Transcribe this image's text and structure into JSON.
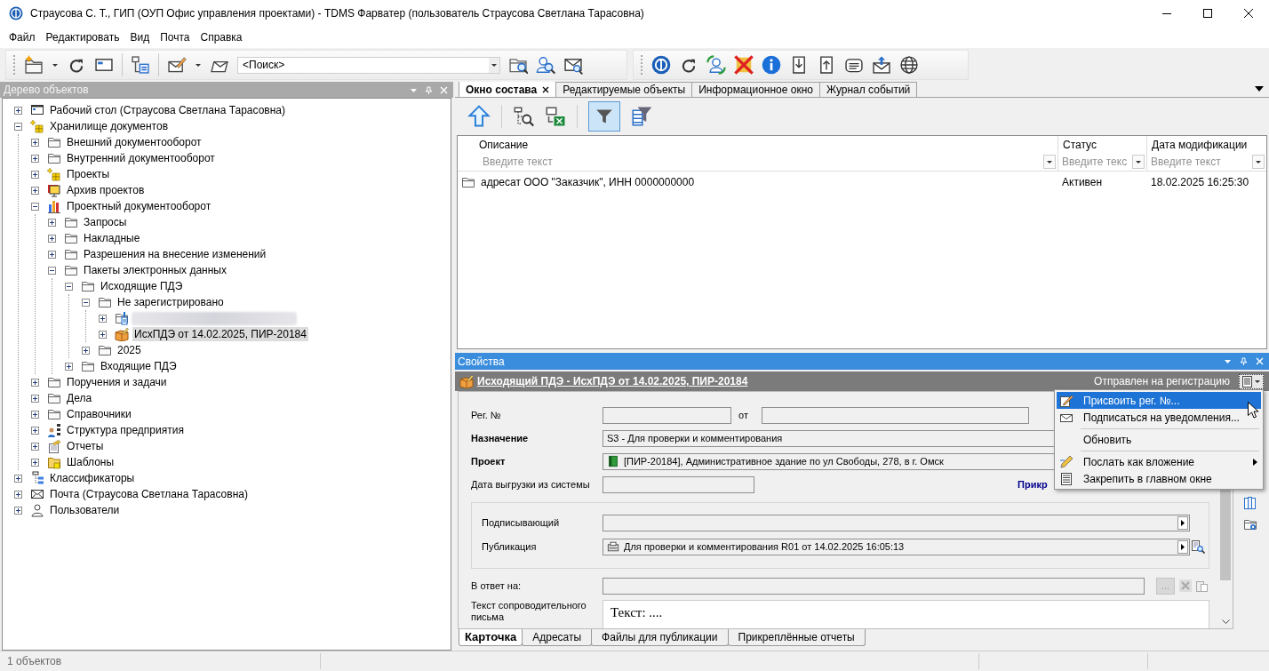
{
  "window": {
    "title": "Страусова С. Т., ГИП (ОУП Офис управления проектами) - TDMS Фарватер (пользователь Страусова Светлана Тарасовна)"
  },
  "menu": [
    "Файл",
    "Редактировать",
    "Вид",
    "Почта",
    "Справка"
  ],
  "toolbar": {
    "search": {
      "value": "<Поиск>"
    }
  },
  "tree_panel": {
    "title": "Дерево объектов",
    "items": [
      {
        "label": "Рабочий стол (Страусова Светлана Тарасовна)",
        "kind": "desktop",
        "expanded": false,
        "selected": false
      },
      {
        "label": "Хранилище документов",
        "kind": "storage",
        "expanded": true,
        "selected": false,
        "children": [
          {
            "label": "Внешний документооборот",
            "kind": "folder",
            "expanded": false,
            "selected": false
          },
          {
            "label": "Внутренний документооборот",
            "kind": "folder",
            "expanded": false,
            "selected": false
          },
          {
            "label": "Проекты",
            "kind": "storage",
            "expanded": false,
            "selected": false
          },
          {
            "label": "Архив проектов",
            "kind": "archive",
            "expanded": false,
            "selected": false
          },
          {
            "label": "Проектный документооборот",
            "kind": "chart",
            "expanded": true,
            "selected": false,
            "children": [
              {
                "label": "Запросы",
                "kind": "folder",
                "expanded": false,
                "selected": false
              },
              {
                "label": "Накладные",
                "kind": "folder",
                "expanded": false,
                "selected": false
              },
              {
                "label": "Разрешения на внесение изменений",
                "kind": "folder",
                "expanded": false,
                "selected": false
              },
              {
                "label": "Пакеты электронных данных",
                "kind": "folder",
                "expanded": true,
                "selected": false,
                "children": [
                  {
                    "label": "Исходящие ПДЭ",
                    "kind": "folder",
                    "expanded": true,
                    "selected": false,
                    "children": [
                      {
                        "label": "Не зарегистрировано",
                        "kind": "folder",
                        "expanded": true,
                        "selected": false,
                        "children": [
                          {
                            "kind": "package",
                            "blurred": true,
                            "expanded": false,
                            "selected": false
                          },
                          {
                            "label": "ИсхПДЭ от 14.02.2025, ПИР-20184",
                            "kind": "outgoing",
                            "expanded": false,
                            "selected": true
                          }
                        ]
                      },
                      {
                        "label": "2025",
                        "kind": "folder",
                        "expanded": false,
                        "selected": false
                      }
                    ]
                  },
                  {
                    "label": "Входящие ПДЭ",
                    "kind": "folder",
                    "expanded": false,
                    "selected": false
                  }
                ]
              }
            ]
          },
          {
            "label": "Поручения и задачи",
            "kind": "folder",
            "expanded": false,
            "selected": false
          },
          {
            "label": "Дела",
            "kind": "folder",
            "expanded": false,
            "selected": false
          },
          {
            "label": "Справочники",
            "kind": "folder",
            "expanded": false,
            "selected": false
          },
          {
            "label": "Структура предприятия",
            "kind": "orgchart",
            "expanded": false,
            "selected": false
          },
          {
            "label": "Отчеты",
            "kind": "reports",
            "expanded": false,
            "selected": false
          },
          {
            "label": "Шаблоны",
            "kind": "templates",
            "expanded": false,
            "selected": false
          }
        ]
      },
      {
        "label": "Классификаторы",
        "kind": "classifier",
        "expanded": false,
        "selected": false
      },
      {
        "label": "Почта (Страусова Светлана Тарасовна)",
        "kind": "mail",
        "expanded": false,
        "selected": false
      },
      {
        "label": "Пользователи",
        "kind": "user",
        "expanded": false,
        "selected": false
      }
    ]
  },
  "document_tabs": [
    {
      "label": "Окно состава",
      "selected": true
    },
    {
      "label": "Редактируемые объекты",
      "selected": false
    },
    {
      "label": "Информационное окно",
      "selected": false
    },
    {
      "label": "Журнал событий",
      "selected": false
    }
  ],
  "composition_toolbar": {
    "filter_on": true
  },
  "grid": {
    "columns": [
      {
        "label": "Описание",
        "filter_placeholder": "Введите текст"
      },
      {
        "label": "Статус",
        "filter_placeholder": "Введите текс"
      },
      {
        "label": "Дата модификации",
        "filter_placeholder": "Введите текст"
      }
    ],
    "rows": [
      {
        "cells": [
          "адресат ООО \"Заказчик\", ИНН 0000000000",
          "Активен",
          "18.02.2025 16:25:30"
        ]
      }
    ]
  },
  "properties": {
    "title": "Свойства",
    "object_title": "Исходящий ПДЭ - ИсхПДЭ от 14.02.2025, ПИР-20184",
    "status": "Отправлен на регистрацию",
    "fields": [
      {
        "kind": "reg",
        "label": "Рег. №",
        "date_label": "от"
      },
      {
        "kind": "text",
        "label": "Назначение",
        "required": true,
        "value": "S3 - Для проверки и комментирования"
      },
      {
        "kind": "project",
        "label": "Проект",
        "required": true,
        "value": "[ПИР-20184], Административное здание по ул Свободы, 278, в г. Омск"
      },
      {
        "kind": "date",
        "label": "Дата выгрузки из системы",
        "required": false,
        "link": "Прикр"
      },
      {
        "kind": "group",
        "fields": [
          {
            "kind": "picker",
            "label": "Подписывающий",
            "required": false
          },
          {
            "kind": "publication",
            "label": "Публикация",
            "required": false,
            "value": "Для проверки и комментирования R01 от 14.02.2025 16:05:13"
          }
        ]
      },
      {
        "kind": "reply",
        "label": "В ответ на:",
        "required": false,
        "button": "..."
      },
      {
        "kind": "memo",
        "label": "Текст сопроводительного письма",
        "required": false,
        "value": "Текст: ...."
      }
    ],
    "tabs": [
      {
        "label": "Карточка",
        "selected": true
      },
      {
        "label": "Адресаты",
        "selected": false
      },
      {
        "label": "Файлы для публикации",
        "selected": false
      },
      {
        "label": "Прикреплённые отчеты",
        "selected": false
      }
    ]
  },
  "context_menu": {
    "items": [
      {
        "kind": "assign",
        "label": "Присвоить рег. №...",
        "selected": true
      },
      {
        "kind": "subscribe",
        "label": "Подписаться на уведомления...",
        "selected": false
      },
      {
        "kind": "separator"
      },
      {
        "kind": "plain",
        "label": "Обновить",
        "selected": false
      },
      {
        "kind": "separator"
      },
      {
        "kind": "send",
        "label": "Послать как вложение",
        "selected": false,
        "submenu": true
      },
      {
        "kind": "pin",
        "label": "Закрепить в главном окне",
        "selected": false
      }
    ]
  },
  "status_bar": {
    "text": "1 объектов"
  }
}
